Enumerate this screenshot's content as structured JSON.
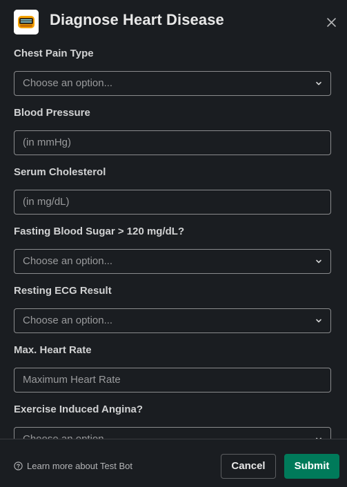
{
  "modal": {
    "title": "Diagnose Heart Disease",
    "close_icon": "close-icon",
    "app_icon": "bot-app-icon"
  },
  "fields": [
    {
      "label": "Chest Pain Type",
      "type": "select",
      "value": "Choose an option..."
    },
    {
      "label": "Blood Pressure",
      "type": "input",
      "placeholder": "(in mmHg)"
    },
    {
      "label": "Serum Cholesterol",
      "type": "input",
      "placeholder": "(in mg/dL)"
    },
    {
      "label": "Fasting Blood Sugar > 120 mg/dL?",
      "type": "select",
      "value": "Choose an option..."
    },
    {
      "label": "Resting ECG Result",
      "type": "select",
      "value": "Choose an option..."
    },
    {
      "label": "Max. Heart Rate",
      "type": "input",
      "placeholder": "Maximum Heart Rate"
    },
    {
      "label": "Exercise Induced Angina?",
      "type": "select",
      "value": "Choose an option..."
    }
  ],
  "footer": {
    "learn_more": "Learn more about Test Bot",
    "cancel_label": "Cancel",
    "submit_label": "Submit"
  },
  "colors": {
    "background": "#1a1d21",
    "submit": "#007a5a",
    "border": "#8b8c8e"
  }
}
